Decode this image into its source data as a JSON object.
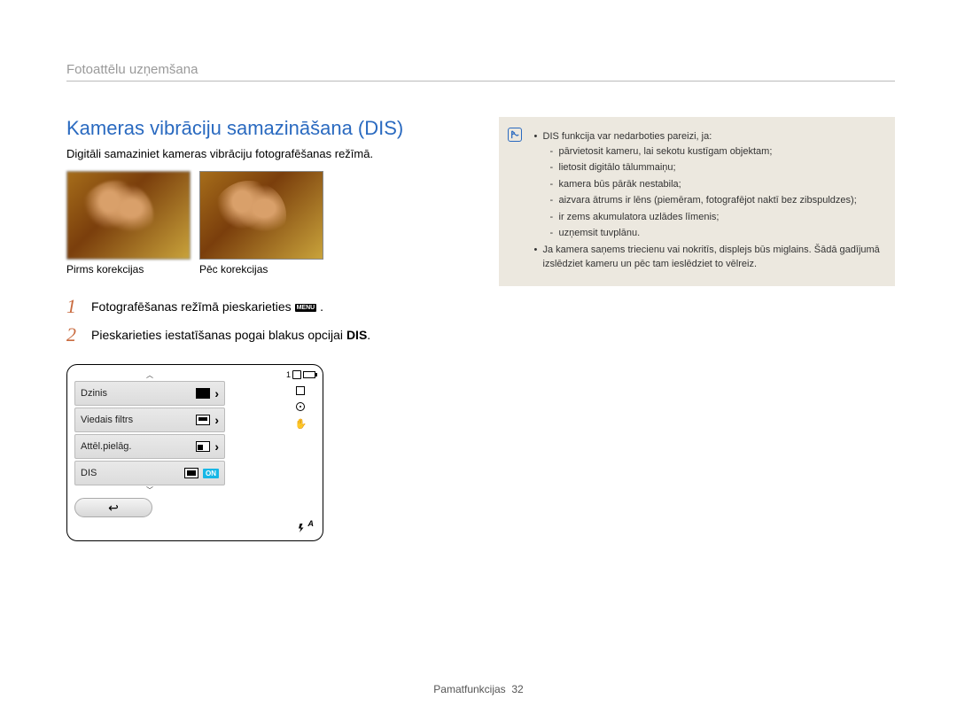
{
  "breadcrumb": "Fotoattēlu uzņemšana",
  "title": "Kameras vibrāciju samazināšana (DIS)",
  "subtitle": "Digitāli samaziniet kameras vibrāciju fotografēšanas režīmā.",
  "captions": {
    "before": "Pirms korekcijas",
    "after": "Pēc korekcijas"
  },
  "steps": {
    "s1": {
      "num": "1",
      "text_a": "Fotografēšanas režīmā pieskarieties ",
      "menu_label": "MENU",
      "text_b": "."
    },
    "s2": {
      "num": "2",
      "text_a": "Pieskarieties iestatīšanas pogai blakus opcijai ",
      "bold": "DIS",
      "text_b": "."
    }
  },
  "camera_ui": {
    "counter": "1",
    "rows": {
      "drive": "Dzinis",
      "filter": "Viedais filtrs",
      "adjust": "Attēl.pielāg.",
      "dis": "DIS"
    },
    "on_badge": "ON",
    "flash_auto": "A"
  },
  "note": {
    "intro": "DIS funkcija var nedarboties pareizi, ja:",
    "items": [
      "pārvietosit kameru, lai sekotu kustīgam objektam;",
      "lietosit digitālo tālummaiņu;",
      "kamera būs pārāk nestabila;",
      "aizvara ātrums ir lēns (piemēram, fotografējot naktī bez zibspuldzes);",
      "ir zems akumulatora uzlādes līmenis;",
      "uzņemsit tuvplānu."
    ],
    "extra": "Ja kamera saņems triecienu vai nokritīs, displejs būs miglains. Šādā gadījumā izslēdziet kameru un pēc tam ieslēdziet to vēlreiz."
  },
  "footer": {
    "label": "Pamatfunkcijas",
    "page": "32"
  }
}
